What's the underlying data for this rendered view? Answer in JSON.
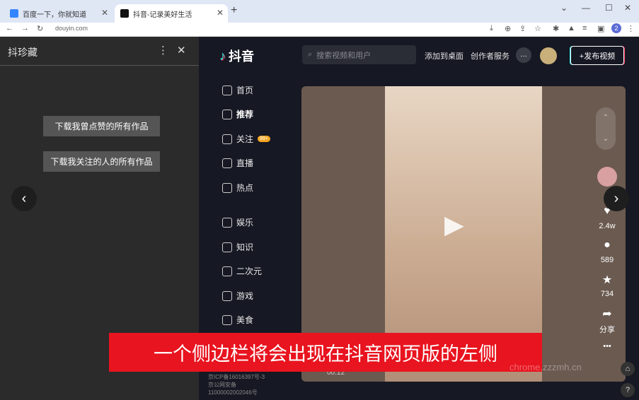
{
  "browser": {
    "tabs": [
      {
        "title": "百度一下，你就知道"
      },
      {
        "title": "抖音-记录美好生活"
      }
    ],
    "url": "douyin.com",
    "profile": "2"
  },
  "sidebar": {
    "title": "抖珍藏",
    "buttons": [
      "下载我曾点赞的所有作品",
      "下载我关注的人的所有作品"
    ]
  },
  "douyin": {
    "logo": "抖音",
    "search_placeholder": "搜索视频和用户",
    "top_links": [
      "添加到桌面",
      "创作者服务"
    ],
    "publish": "+发布视频",
    "nav": [
      {
        "label": "首页"
      },
      {
        "label": "推荐"
      },
      {
        "label": "关注",
        "badge": "99+"
      },
      {
        "label": "直播"
      },
      {
        "label": "热点"
      },
      {
        "label": "娱乐"
      },
      {
        "label": "知识"
      },
      {
        "label": "二次元"
      },
      {
        "label": "游戏"
      },
      {
        "label": "美食"
      }
    ],
    "stats": {
      "likes": "2.4w",
      "comments": "589",
      "favorites": "734",
      "share": "分享"
    },
    "time": "00:12",
    "footer": [
      "京ICP备16016397号-3",
      "京公网安备",
      "11000002002046号"
    ]
  },
  "caption": "一个侧边栏将会出现在抖音网页版的左侧",
  "watermark": "chrome.zzzmh.cn"
}
